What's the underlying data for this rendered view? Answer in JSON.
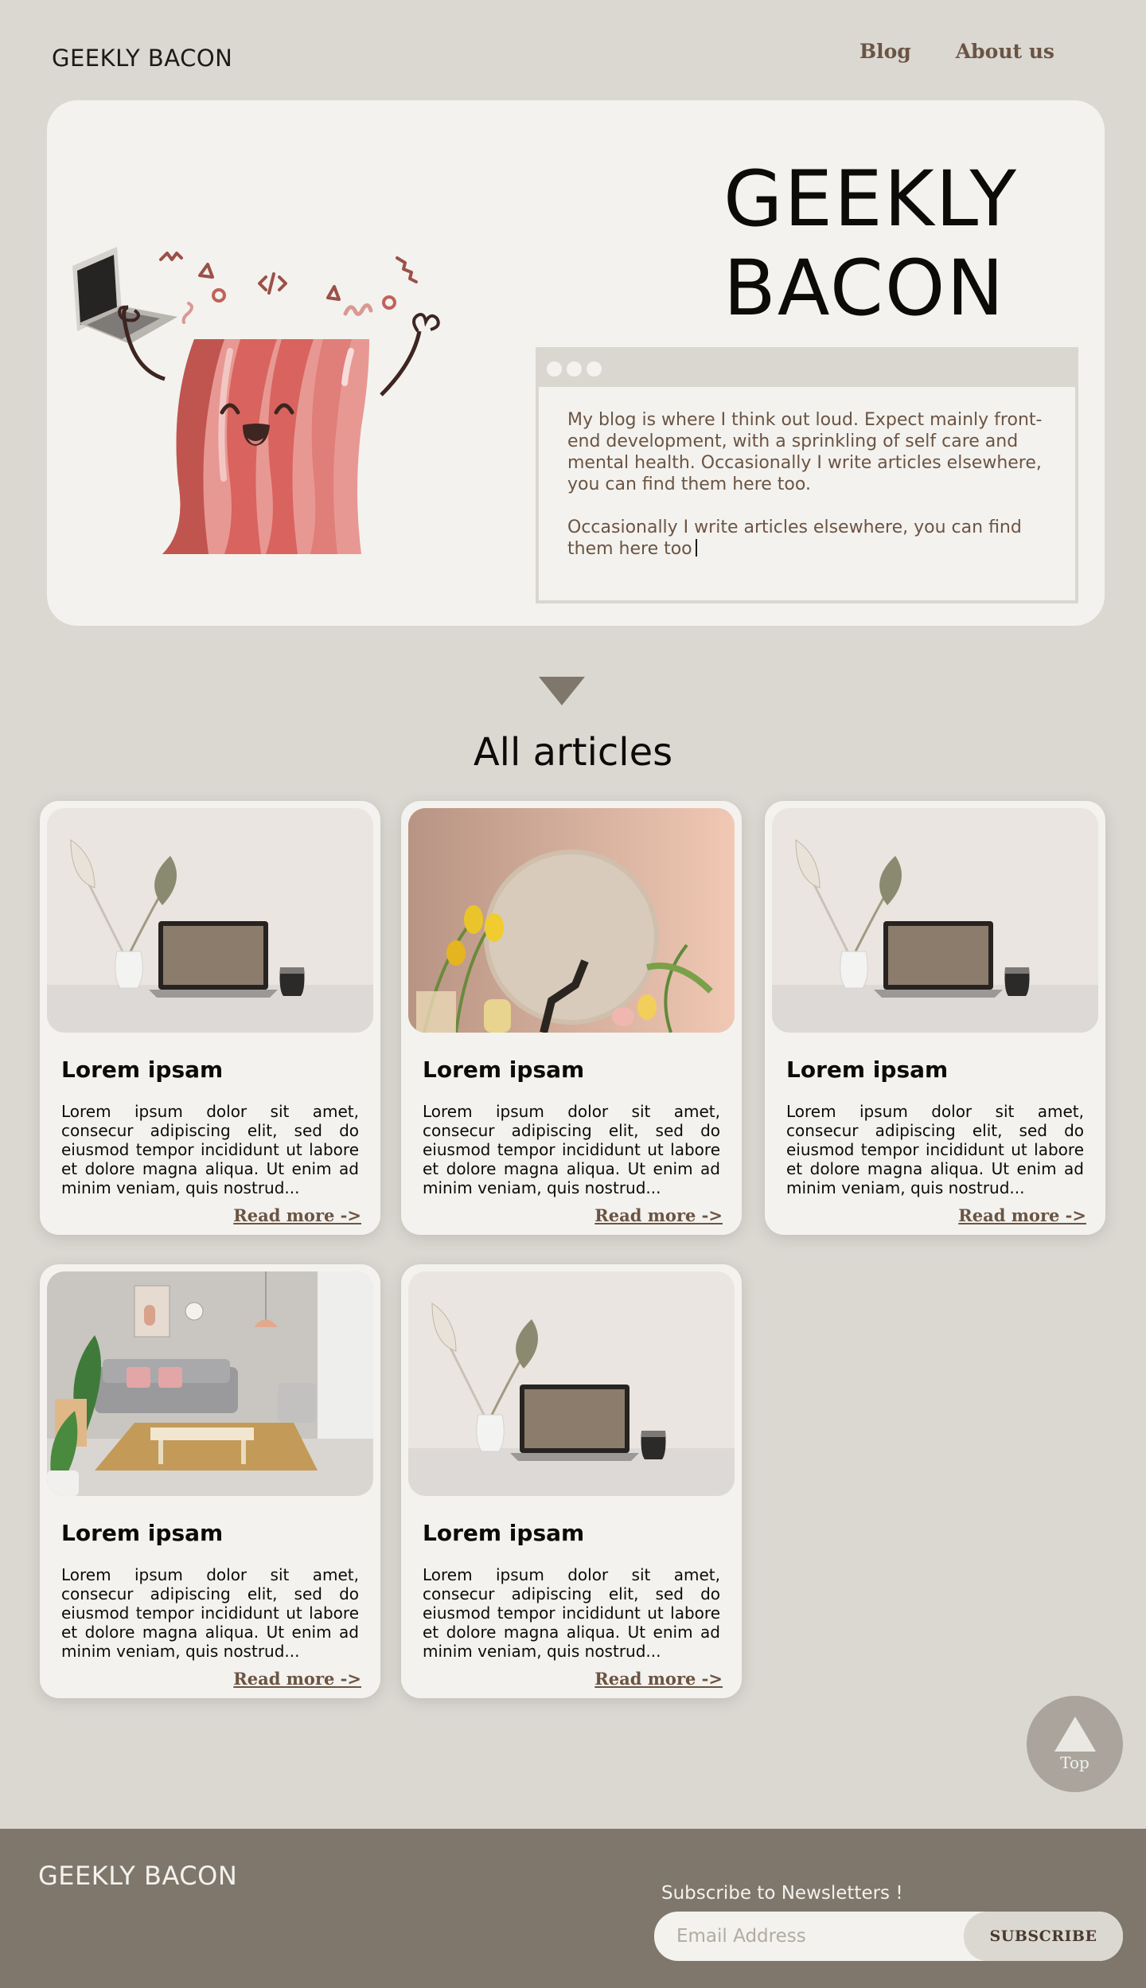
{
  "header": {
    "brand": "GEEKLY BACON",
    "nav": [
      "Blog",
      "About us"
    ]
  },
  "hero": {
    "title_line1": "GEEKLY",
    "title_line2": "BACON",
    "paragraph1": "My blog is where I think out loud. Expect mainly front-end development, with a sprinkling of self care and mental health.  Occasionally I write articles elsewhere, you can find them here too.",
    "paragraph2": "Occasionally I write articles elsewhere, you can find them here too"
  },
  "articles": {
    "heading": "All articles",
    "items": [
      {
        "title": "Lorem ipsam",
        "excerpt": "Lorem ipsum dolor sit amet, consecur adipiscing elit, sed do eiusmod tempor incididunt ut labore et dolore magna aliqua. Ut enim ad minim veniam, quis nostrud...",
        "link": "Read more ->",
        "image": "laptop-plants"
      },
      {
        "title": "Lorem ipsam",
        "excerpt": "Lorem ipsum dolor sit amet, consecur adipiscing elit, sed do eiusmod tempor incididunt ut labore et dolore magna aliqua. Ut enim ad minim veniam, quis nostrud...",
        "link": "Read more ->",
        "image": "tulips-mirror"
      },
      {
        "title": "Lorem ipsam",
        "excerpt": "Lorem ipsum dolor sit amet, consecur adipiscing elit, sed do eiusmod tempor incididunt ut labore et dolore magna aliqua. Ut enim ad minim veniam, quis nostrud...",
        "link": "Read more ->",
        "image": "laptop-plants"
      },
      {
        "title": "Lorem ipsam",
        "excerpt": "Lorem ipsum dolor sit amet, consecur adipiscing elit, sed do eiusmod tempor incididunt ut labore et dolore magna aliqua. Ut enim ad minim veniam, quis nostrud...",
        "link": "Read more ->",
        "image": "living-room"
      },
      {
        "title": "Lorem ipsam",
        "excerpt": "Lorem ipsum dolor sit amet, consecur adipiscing elit, sed do eiusmod tempor incididunt ut labore et dolore magna aliqua. Ut enim ad minim veniam, quis nostrud...",
        "link": "Read more ->",
        "image": "laptop-plants"
      }
    ]
  },
  "top_button": {
    "label": "Top",
    "icon": "triangle-up-icon"
  },
  "footer": {
    "brand": "GEEKLY BACON",
    "subscribe_label": "Subscribe to Newsletters !",
    "email_placeholder": "Email Address",
    "subscribe_button": "SUBSCRIBE"
  },
  "colors": {
    "background": "#dbd8d2",
    "surface": "#f3f2ee",
    "accent_brown": "#6b5444",
    "footer": "#7f776c",
    "bacon_red": "#d9635e"
  }
}
